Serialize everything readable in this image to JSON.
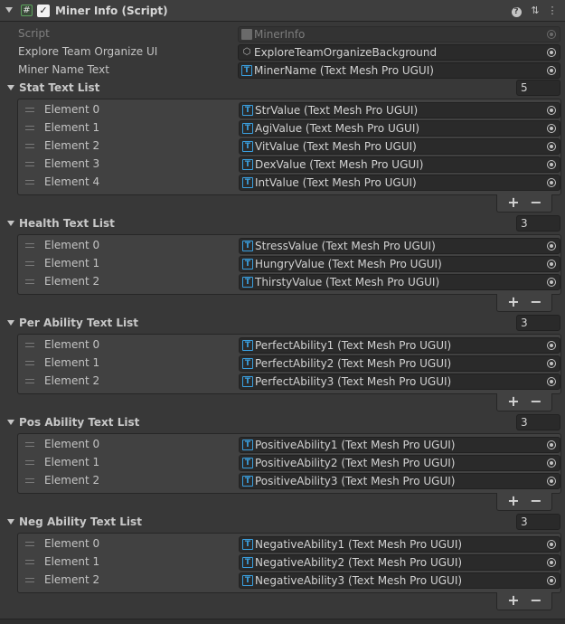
{
  "component": {
    "title": "Miner Info (Script)",
    "enabled": true,
    "icons": {
      "fold": "triangle-down-icon",
      "script": "script-icon",
      "help": "help-icon",
      "preset": "preset-icon",
      "menu": "kebab-menu-icon"
    }
  },
  "properties": [
    {
      "label": "Script",
      "value": "MinerInfo",
      "icon": "file-icon",
      "disabled": true
    },
    {
      "label": "Explore Team Organize UI",
      "value": "ExploreTeamOrganizeBackground",
      "icon": "cube-icon",
      "disabled": false
    },
    {
      "label": "Miner Name Text",
      "value": "MinerName (Text Mesh Pro UGUI)",
      "icon": "tmp-icon",
      "disabled": false
    }
  ],
  "lists": [
    {
      "title": "Stat Text List",
      "size": "5",
      "elements": [
        {
          "label": "Element 0",
          "value": "StrValue (Text Mesh Pro UGUI)"
        },
        {
          "label": "Element 1",
          "value": "AgiValue (Text Mesh Pro UGUI)"
        },
        {
          "label": "Element 2",
          "value": "VitValue (Text Mesh Pro UGUI)"
        },
        {
          "label": "Element 3",
          "value": "DexValue (Text Mesh Pro UGUI)"
        },
        {
          "label": "Element 4",
          "value": "IntValue (Text Mesh Pro UGUI)"
        }
      ]
    },
    {
      "title": "Health Text List",
      "size": "3",
      "elements": [
        {
          "label": "Element 0",
          "value": "StressValue (Text Mesh Pro UGUI)"
        },
        {
          "label": "Element 1",
          "value": "HungryValue (Text Mesh Pro UGUI)"
        },
        {
          "label": "Element 2",
          "value": "ThirstyValue (Text Mesh Pro UGUI)"
        }
      ]
    },
    {
      "title": "Per Ability Text List",
      "size": "3",
      "elements": [
        {
          "label": "Element 0",
          "value": "PerfectAbility1 (Text Mesh Pro UGUI)"
        },
        {
          "label": "Element 1",
          "value": "PerfectAbility2 (Text Mesh Pro UGUI)"
        },
        {
          "label": "Element 2",
          "value": "PerfectAbility3 (Text Mesh Pro UGUI)"
        }
      ]
    },
    {
      "title": "Pos Ability Text List",
      "size": "3",
      "elements": [
        {
          "label": "Element 0",
          "value": "PositiveAbility1 (Text Mesh Pro UGUI)"
        },
        {
          "label": "Element 1",
          "value": "PositiveAbility2 (Text Mesh Pro UGUI)"
        },
        {
          "label": "Element 2",
          "value": "PositiveAbility3 (Text Mesh Pro UGUI)"
        }
      ]
    },
    {
      "title": "Neg Ability Text List",
      "size": "3",
      "elements": [
        {
          "label": "Element 0",
          "value": "NegativeAbility1 (Text Mesh Pro UGUI)"
        },
        {
          "label": "Element 1",
          "value": "NegativeAbility2 (Text Mesh Pro UGUI)"
        },
        {
          "label": "Element 2",
          "value": "NegativeAbility3 (Text Mesh Pro UGUI)"
        }
      ]
    }
  ],
  "footer": {
    "add_label": "+",
    "remove_label": "−"
  },
  "colors": {
    "background": "#383838",
    "field": "#2a2a2a",
    "list_box": "#414141",
    "tmp_icon": "#3aa0e0"
  }
}
